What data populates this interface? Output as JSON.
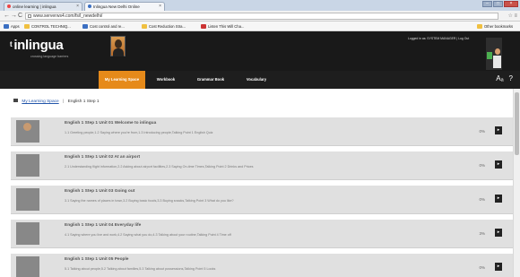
{
  "browser": {
    "tabs": [
      {
        "label": "online learning | inlingua"
      },
      {
        "label": "Inlingua New Delhi Online"
      }
    ],
    "url": "www.serverws4.com/fs/l_newdelhi/",
    "bookmarks": [
      {
        "label": "Apps",
        "icon": "apps-icon"
      },
      {
        "label": "CONTROL TECHNIQ...",
        "icon": "folder-icon"
      },
      {
        "label": "Cost control and re...",
        "icon": "page-icon"
      },
      {
        "label": "Cost Reduction Stra...",
        "icon": "folder-icon"
      },
      {
        "label": "Listen This Will Cha...",
        "icon": "youtube-icon"
      }
    ],
    "other_bookmarks": "Other bookmarks"
  },
  "header": {
    "logo": "inlingua",
    "tagline": "crossing language barriers",
    "logged_in": "Logged in as: SYSTEM MANAGER | Log Out"
  },
  "nav": {
    "tabs": [
      {
        "label": "My Learning Space",
        "active": true
      },
      {
        "label": "Workbook",
        "active": false
      },
      {
        "label": "Grammar Book",
        "active": false
      },
      {
        "label": "Vocabulary",
        "active": false
      }
    ],
    "accent_color": "#e68a1a"
  },
  "breadcrumb": {
    "home": "My Learning Space",
    "current": "English 1 Step 1"
  },
  "units": [
    {
      "title": "English 1 Step 1 Unit 01 Welcome to inlingua",
      "topics": "1.1 Greeting people,1.2 Saying where you're from,1.3 Introducing people,Talking Point 1 English Quiz",
      "progress": "0%"
    },
    {
      "title": "English 1 Step 1 Unit 02 At an airport",
      "topics": "2.1 Understanding flight information,2.2 Asking about airport facilities,2.3 Saying On-time Times,Talking Point 2 Drinks and Prices",
      "progress": "0%"
    },
    {
      "title": "English 1 Step 1 Unit 03 Going out",
      "topics": "3.1 Saying the names of places in town,3.2 Buying basic foods,3.3 Buying snacks,Talking Point 3 What do you like?",
      "progress": "0%"
    },
    {
      "title": "English 1 Step 1 Unit 04 Everyday life",
      "topics": "4.1 Saying where you live and work,4.2 Saying what you do,4.3 Talking about your routine,Talking Point 4 Time off",
      "progress": "3%"
    },
    {
      "title": "English 1 Step 1 Unit 05 People",
      "topics": "5.1 Talking about people,5.2 Talking about families,5.3 Talking about possessions,Talking Point 5 Looks",
      "progress": "0%"
    }
  ]
}
